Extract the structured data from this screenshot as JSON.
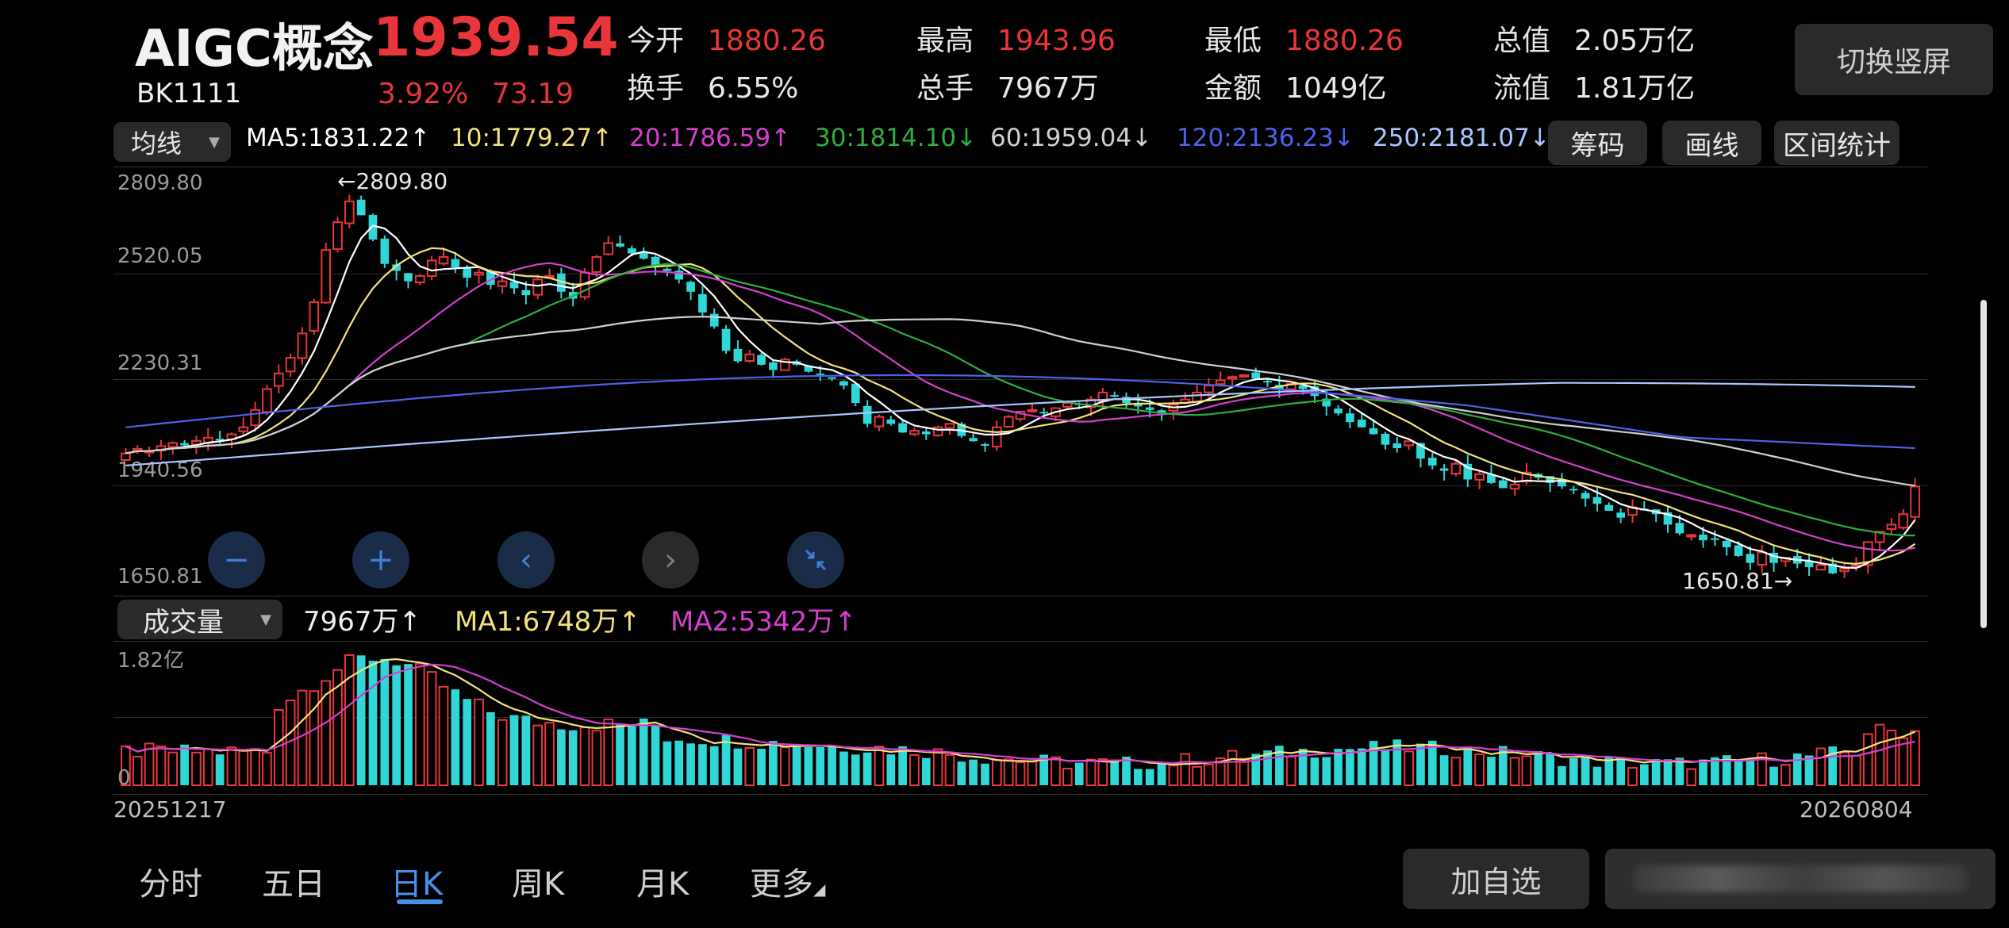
{
  "header": {
    "name": "AIGC概念",
    "code": "BK1111",
    "price": "1939.54",
    "change_pct": "3.92%",
    "change_val": "73.19",
    "stats": [
      {
        "label": "今开",
        "value": "1880.26",
        "color": "#e8363b"
      },
      {
        "label": "最高",
        "value": "1943.96",
        "color": "#e8363b"
      },
      {
        "label": "最低",
        "value": "1880.26",
        "color": "#e8363b"
      },
      {
        "label": "总值",
        "value": "2.05万亿",
        "color": "#e8e8e8"
      },
      {
        "label": "换手",
        "value": "6.55%",
        "color": "#e8e8e8"
      },
      {
        "label": "总手",
        "value": "7967万",
        "color": "#e8e8e8"
      },
      {
        "label": "金额",
        "value": "1049亿",
        "color": "#e8e8e8"
      },
      {
        "label": "流值",
        "value": "1.81万亿",
        "color": "#e8e8e8"
      }
    ],
    "switch_button": "切换竖屏"
  },
  "ma_bar": {
    "selector": "均线",
    "items": [
      {
        "text": "MA5:1831.22",
        "arrow": "↑",
        "color": "#ffffff"
      },
      {
        "text": "10:1779.27",
        "arrow": "↑",
        "color": "#f3e37b"
      },
      {
        "text": "20:1786.59",
        "arrow": "↑",
        "color": "#d43fd0"
      },
      {
        "text": "30:1814.10",
        "arrow": "↓",
        "color": "#2fae3d"
      },
      {
        "text": "60:1959.04",
        "arrow": "↓",
        "color": "#d0d0d0"
      },
      {
        "text": "120:2136.23",
        "arrow": "↓",
        "color": "#4d62e8"
      },
      {
        "text": "250:2181.07",
        "arrow": "↓",
        "color": "#a9c6ff"
      }
    ],
    "buttons": [
      "筹码",
      "画线",
      "区间统计"
    ]
  },
  "price_axis": [
    "2809.80",
    "2520.05",
    "2230.31",
    "1940.56",
    "1650.81"
  ],
  "annotations": {
    "high": "←2809.80",
    "low": "1650.81→"
  },
  "volume": {
    "selector": "成交量",
    "current": "7967万",
    "current_arrow": "↑",
    "ma1": "MA1:6748万",
    "ma1_arrow": "↑",
    "ma2": "MA2:5342万",
    "ma2_arrow": "↑",
    "axis_top": "1.82亿",
    "axis_zero": "0"
  },
  "date_range": {
    "start": "20251217",
    "end": "20260804"
  },
  "controls": [
    "zoom-out",
    "zoom-in",
    "prev",
    "next",
    "shrink"
  ],
  "bottom_tabs": [
    {
      "label": "分时",
      "active": false
    },
    {
      "label": "五日",
      "active": false
    },
    {
      "label": "日K",
      "active": true
    },
    {
      "label": "周K",
      "active": false
    },
    {
      "label": "月K",
      "active": false
    },
    {
      "label": "更多",
      "active": false
    }
  ],
  "bottom_buttons": {
    "add_watch": "加自选"
  },
  "chart_data": {
    "type": "candlestick",
    "ylim": [
      1650.81,
      2809.8
    ],
    "closes": [
      2035,
      2048,
      2042,
      2056,
      2065,
      2058,
      2071,
      2080,
      2075,
      2090,
      2110,
      2160,
      2220,
      2265,
      2310,
      2380,
      2470,
      2620,
      2700,
      2760,
      2720,
      2650,
      2580,
      2560,
      2530,
      2545,
      2590,
      2600,
      2570,
      2540,
      2555,
      2520,
      2530,
      2510,
      2490,
      2535,
      2545,
      2500,
      2480,
      2555,
      2600,
      2640,
      2630,
      2610,
      2595,
      2570,
      2560,
      2535,
      2500,
      2440,
      2400,
      2330,
      2300,
      2320,
      2290,
      2275,
      2305,
      2290,
      2270,
      2260,
      2250,
      2230,
      2180,
      2120,
      2140,
      2120,
      2095,
      2100,
      2090,
      2110,
      2120,
      2085,
      2070,
      2060,
      2110,
      2140,
      2155,
      2160,
      2150,
      2165,
      2180,
      2175,
      2190,
      2210,
      2200,
      2180,
      2170,
      2160,
      2150,
      2175,
      2190,
      2210,
      2230,
      2245,
      2255,
      2260,
      2250,
      2240,
      2220,
      2235,
      2220,
      2200,
      2170,
      2150,
      2125,
      2110,
      2090,
      2060,
      2050,
      2070,
      2020,
      2000,
      1985,
      2005,
      1960,
      1975,
      1950,
      1935,
      1945,
      1980,
      1965,
      1950,
      1940,
      1930,
      1905,
      1890,
      1870,
      1850,
      1880,
      1875,
      1860,
      1830,
      1805,
      1800,
      1785,
      1790,
      1765,
      1740,
      1720,
      1750,
      1720,
      1735,
      1718,
      1708,
      1714,
      1690,
      1703,
      1712,
      1780,
      1810,
      1830,
      1860,
      1939.54
    ]
  }
}
